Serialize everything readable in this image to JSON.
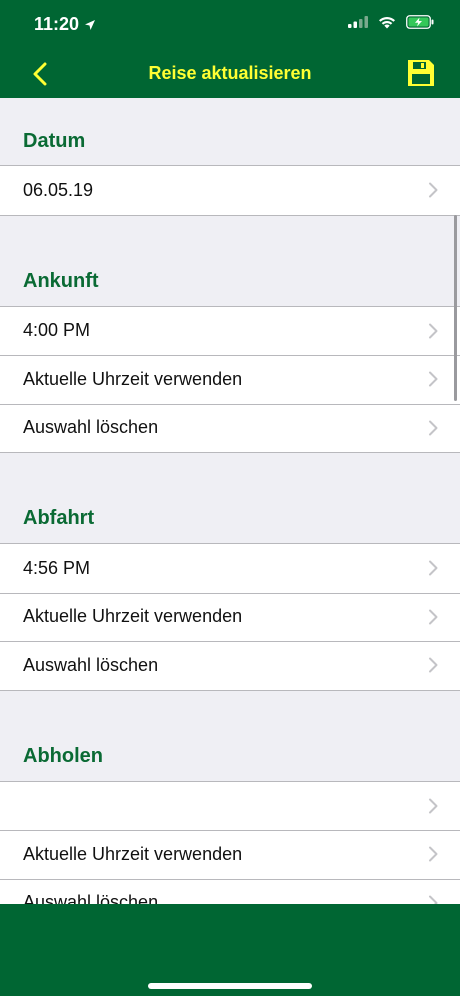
{
  "status": {
    "time": "11:20"
  },
  "nav": {
    "title": "Reise aktualisieren"
  },
  "sections": {
    "datum": {
      "title": "Datum",
      "rows": [
        "06.05.19"
      ]
    },
    "ankunft": {
      "title": "Ankunft",
      "rows": [
        "4:00 PM",
        "Aktuelle Uhrzeit verwenden",
        "Auswahl löschen"
      ]
    },
    "abfahrt": {
      "title": "Abfahrt",
      "rows": [
        "4:56 PM",
        "Aktuelle Uhrzeit verwenden",
        "Auswahl löschen"
      ]
    },
    "abholen": {
      "title": "Abholen",
      "rows": [
        "",
        "Aktuelle Uhrzeit verwenden",
        "Auswahl löschen"
      ]
    }
  },
  "colors": {
    "bar_green": "#006633",
    "title_yellow": "#ffff33",
    "section_green": "#0a6a34"
  }
}
